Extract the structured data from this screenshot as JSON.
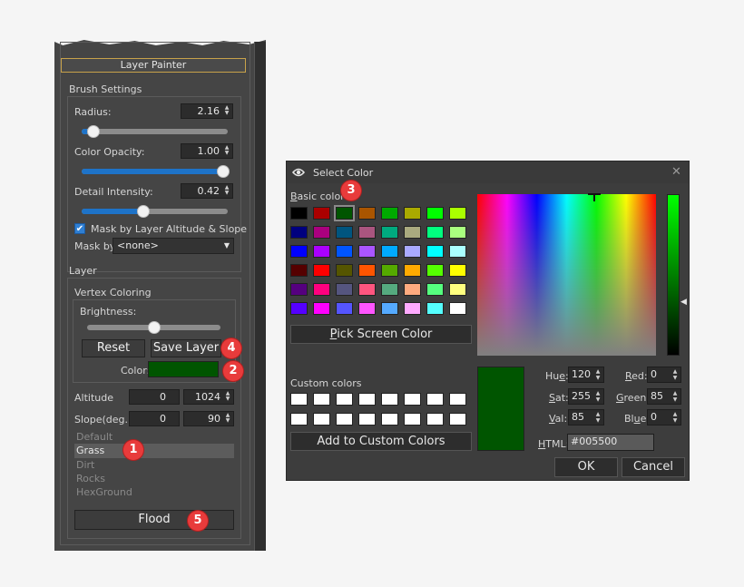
{
  "panel": {
    "title": "Layer Painter",
    "brush_settings": "Brush Settings",
    "radius": {
      "label": "Radius:",
      "value": "2.16",
      "slider": 0.05
    },
    "color_opacity": {
      "label": "Color Opacity:",
      "value": "1.00",
      "slider": 1.0
    },
    "detail_intensity": {
      "label": "Detail Intensity:",
      "value": "0.42",
      "slider": 0.42
    },
    "mask_check": {
      "label": "Mask by Layer Altitude & Slope",
      "checked": true
    },
    "mask_by": {
      "label": "Mask by",
      "value": "<none>"
    },
    "layer_section": "Layer",
    "vertex_coloring": "Vertex Coloring",
    "brightness": {
      "label": "Brightness:",
      "slider": 0.5
    },
    "reset_label": "Reset",
    "save_layer_label": "Save Layer",
    "color_label": "Color:",
    "color_value": "#005500",
    "altitude": {
      "label": "Altitude",
      "min": "0",
      "max": "1024"
    },
    "slope": {
      "label": "Slope(deg.)",
      "min": "0",
      "max": "90"
    },
    "layers": [
      "Default",
      "Grass",
      "Dirt",
      "Rocks",
      "HexGround"
    ],
    "selected_layer": "Grass",
    "flood_label": "Flood",
    "badges": {
      "b1": "1",
      "b2": "2",
      "b3": "3",
      "b4": "4",
      "b5": "5"
    }
  },
  "dialog": {
    "title": "Select Color",
    "close_icon": "close-icon",
    "basic_colors_label": "Basic colors",
    "basic_colors": [
      "#000000",
      "#aa0000",
      "#005500",
      "#aa5500",
      "#00aa00",
      "#aaaa00",
      "#00ff00",
      "#aaff00",
      "#00007f",
      "#aa007f",
      "#00557f",
      "#aa557f",
      "#00aa7f",
      "#aaaa7f",
      "#00ff7f",
      "#aaff7f",
      "#0000ff",
      "#aa00ff",
      "#0055ff",
      "#aa55ff",
      "#00aaff",
      "#aaaaff",
      "#00ffff",
      "#aaffff",
      "#550000",
      "#ff0000",
      "#555500",
      "#ff5500",
      "#55aa00",
      "#ffaa00",
      "#55ff00",
      "#ffff00",
      "#55007f",
      "#ff007f",
      "#55557f",
      "#ff557f",
      "#55aa7f",
      "#ffaa7f",
      "#55ff7f",
      "#ffff7f",
      "#5500ff",
      "#ff00ff",
      "#5555ff",
      "#ff55ff",
      "#55aaff",
      "#ffaaff",
      "#55ffff",
      "#ffffff"
    ],
    "selected_basic_index": 2,
    "pick_screen_label": "Pick Screen Color",
    "custom_colors_label": "Custom colors",
    "add_custom_label": "Add to Custom Colors",
    "hue": {
      "label": "Hue:",
      "value": "120"
    },
    "sat": {
      "label": "Sat:",
      "value": "255"
    },
    "val": {
      "label": "Val:",
      "value": "85"
    },
    "red": {
      "label": "Red:",
      "value": "0"
    },
    "green": {
      "label": "Green:",
      "value": "85"
    },
    "blue": {
      "label": "Blue:",
      "value": "0"
    },
    "html": {
      "label": "HTML:",
      "value": "#005500"
    },
    "current_color": "#005500",
    "ok_label": "OK",
    "cancel_label": "Cancel"
  }
}
